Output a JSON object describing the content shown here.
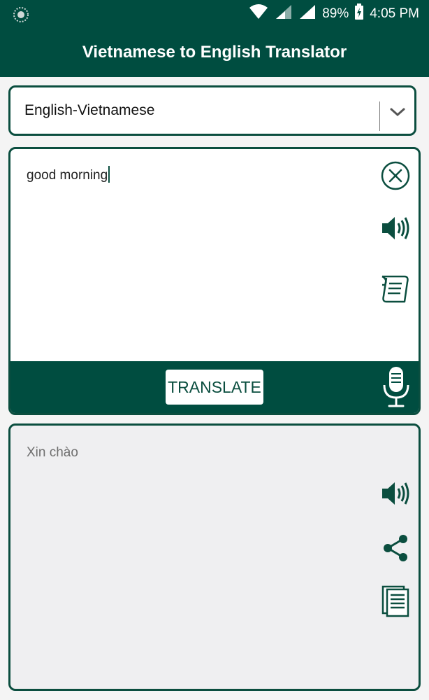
{
  "status_bar": {
    "battery": "89%",
    "time": "4:05 PM"
  },
  "app_bar": {
    "title": "Vietnamese to English Translator"
  },
  "language_selector": {
    "selected": "English-Vietnamese"
  },
  "input": {
    "text": "good morning"
  },
  "actions": {
    "translate_label": "TRANSLATE"
  },
  "output": {
    "text": "Xin chào"
  },
  "icons": {
    "input_panel": [
      "close-circle-icon",
      "speaker-icon",
      "paste-scroll-icon"
    ],
    "action_strip": [
      "microphone-icon"
    ],
    "output_panel": [
      "speaker-icon",
      "share-icon",
      "copy-document-icon"
    ]
  },
  "colors": {
    "primary": "#004d40",
    "accent_border": "#0b4e3f",
    "output_background": "#efeff1"
  }
}
